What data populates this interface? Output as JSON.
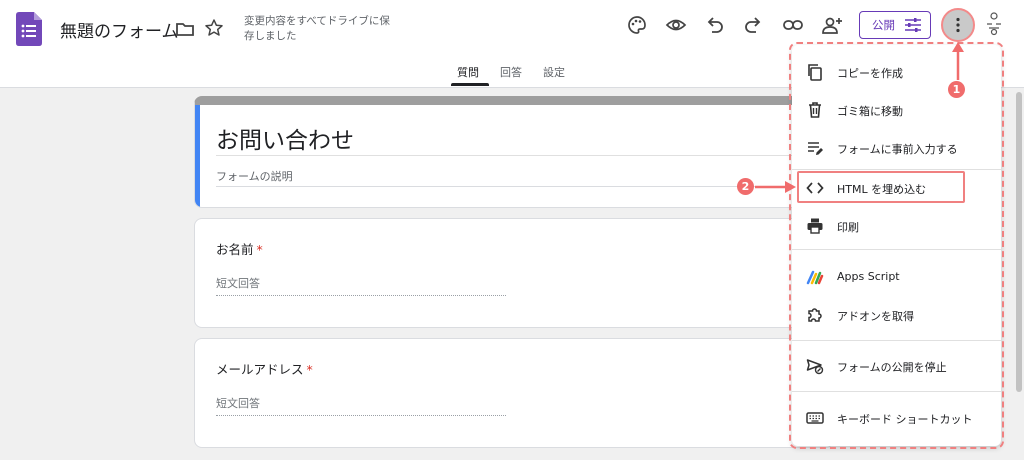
{
  "header": {
    "title": "無題のフォーム",
    "save_status": "変更内容をすべてドライブに保存しました",
    "publish_label": "公開",
    "icons": [
      "forms-logo-icon",
      "folder-icon",
      "star-icon",
      "palette-icon",
      "preview-eye-icon",
      "undo-icon",
      "redo-icon",
      "link-icon",
      "add-collaborator-icon",
      "tune-icon",
      "more-vert-icon",
      "account-icon"
    ]
  },
  "tabs": [
    {
      "label": "質問",
      "active": true
    },
    {
      "label": "回答",
      "active": false
    },
    {
      "label": "設定",
      "active": false
    }
  ],
  "form": {
    "title": "お問い合わせ",
    "description_placeholder": "フォームの説明",
    "questions": [
      {
        "label": "お名前",
        "required_mark": "*",
        "placeholder": "短文回答"
      },
      {
        "label": "メールアドレス",
        "required_mark": "*",
        "placeholder": "短文回答"
      }
    ]
  },
  "menu": {
    "items": [
      {
        "label": "コピーを作成",
        "icon": "copy-icon"
      },
      {
        "label": "ゴミ箱に移動",
        "icon": "trash-icon"
      },
      {
        "label": "フォームに事前入力する",
        "icon": "prefill-icon"
      },
      {
        "label": "HTML を埋め込む",
        "icon": "embed-code-icon"
      },
      {
        "label": "印刷",
        "icon": "print-icon"
      },
      {
        "label": "Apps Script",
        "icon": "apps-script-icon"
      },
      {
        "label": "アドオンを取得",
        "icon": "addon-puzzle-icon"
      },
      {
        "label": "フォームの公開を停止",
        "icon": "unpublish-icon"
      },
      {
        "label": "キーボード ショートカット",
        "icon": "keyboard-icon"
      }
    ]
  },
  "annotations": {
    "step1": "1",
    "step2": "2",
    "color": "#f06c6c"
  },
  "colors": {
    "brand_purple": "#673ab7",
    "accent_blue": "#4285f4",
    "required_red": "#d93025"
  }
}
